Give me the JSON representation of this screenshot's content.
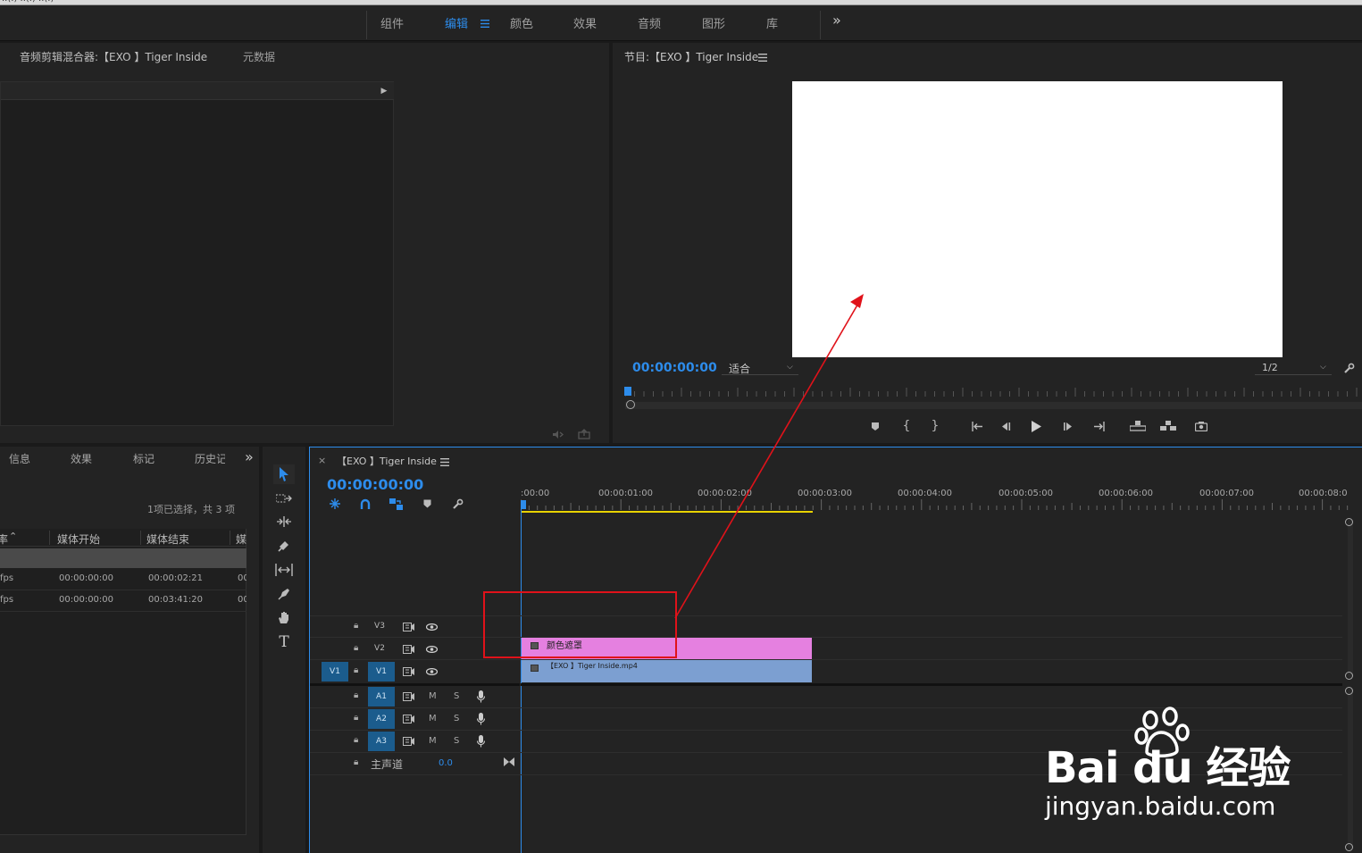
{
  "menubar": {
    "partial_text": "..(.)  ..(.)  ..(.)"
  },
  "workspaces": {
    "tabs": [
      {
        "label": "组件"
      },
      {
        "label": "编辑",
        "active": true
      },
      {
        "label": "颜色"
      },
      {
        "label": "效果"
      },
      {
        "label": "音频"
      },
      {
        "label": "图形"
      },
      {
        "label": "库"
      }
    ],
    "more": "»"
  },
  "source_panel": {
    "tabs": [
      "音频剪辑混合器:【EXO 】Tiger Inside",
      "元数据"
    ]
  },
  "program_monitor": {
    "title": "节目:【EXO 】Tiger Inside",
    "timecode": "00:00:00:00",
    "fit_label": "适合",
    "resolution": "1/2"
  },
  "project_panel": {
    "tabs": [
      "信息",
      "效果",
      "标记",
      "历史记"
    ],
    "more": "»",
    "selection_status": "1项已选择，共 3 项",
    "columns": [
      "率",
      "媒体开始",
      "媒体结束",
      "媒"
    ],
    "rows": [
      {
        "rate": "fps",
        "start": "00:00:00:00",
        "end": "00:00:02:21",
        "extra": "00"
      },
      {
        "rate": "fps",
        "start": "00:00:00:00",
        "end": "00:03:41:20",
        "extra": "00"
      }
    ]
  },
  "timeline": {
    "sequence_title": "【EXO 】Tiger Inside",
    "close": "×",
    "timecode": "00:00:00:00",
    "ruler_labels": [
      ":00:00",
      "00:00:01:00",
      "00:00:02:00",
      "00:00:03:00",
      "00:00:04:00",
      "00:00:05:00",
      "00:00:06:00",
      "00:00:07:00",
      "00:00:08:0"
    ],
    "video_tracks": [
      {
        "name": "V3"
      },
      {
        "name": "V2"
      },
      {
        "name": "V1",
        "source": "V1"
      }
    ],
    "audio_tracks": [
      {
        "name": "A1",
        "m": "M",
        "s": "S"
      },
      {
        "name": "A2",
        "m": "M",
        "s": "S"
      },
      {
        "name": "A3",
        "m": "M",
        "s": "S"
      }
    ],
    "master": {
      "label": "主声道",
      "value": "0.0"
    },
    "clips": [
      {
        "label": "颜色遮罩",
        "track": "V2",
        "color": "#e580e0",
        "start_sec": 0,
        "end_sec": 2.9
      },
      {
        "label": "【EXO 】Tiger Inside.mp4",
        "track": "V1",
        "color": "#7c9fd1",
        "start_sec": 0,
        "end_sec": 2.9
      }
    ]
  },
  "watermark": {
    "brand": "Bai du 经验",
    "url": "jingyan.baidu.com"
  },
  "colors": {
    "accent": "#2d8ceb",
    "annotation": "#e0121a",
    "work_area": "#e8d200"
  }
}
